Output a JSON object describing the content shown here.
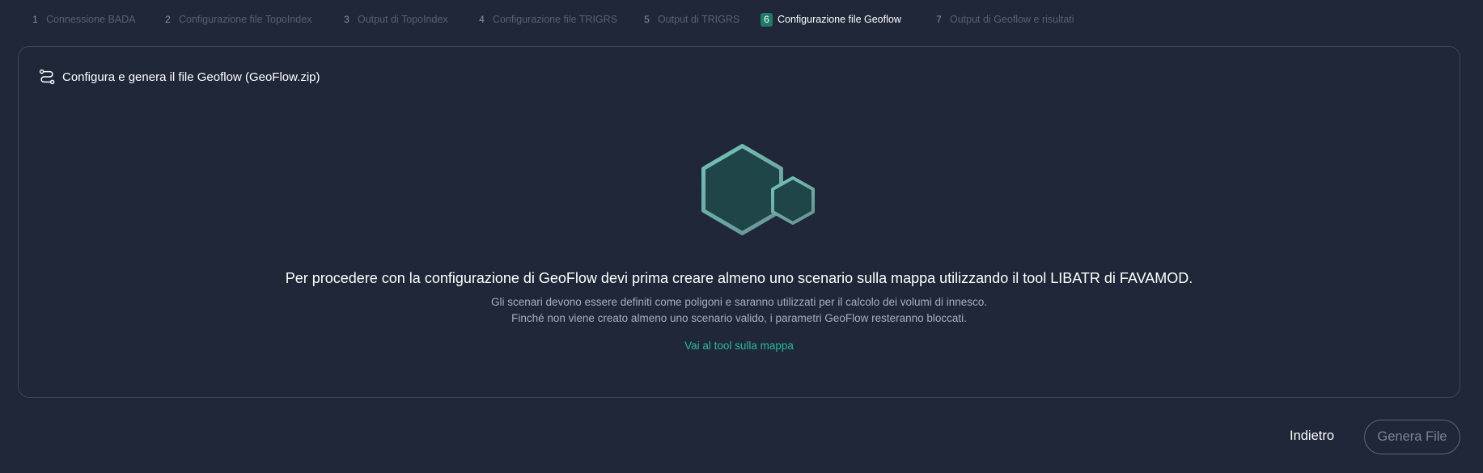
{
  "stepper": {
    "steps": [
      {
        "number": "1",
        "label": "Connessione BADA"
      },
      {
        "number": "2",
        "label": "Configurazione file TopoIndex"
      },
      {
        "number": "3",
        "label": "Output di TopoIndex"
      },
      {
        "number": "4",
        "label": "Configurazione file TRIGRS"
      },
      {
        "number": "5",
        "label": "Output di TRIGRS"
      },
      {
        "number": "6",
        "label": "Configurazione file Geoflow"
      },
      {
        "number": "7",
        "label": "Output di Geoflow e risultati"
      }
    ],
    "active_step": "6"
  },
  "card": {
    "title": "Configura e genera il file Geoflow (GeoFlow.zip)",
    "title_icon": "route-icon",
    "illustration_icon": "hexagons-icon",
    "message": "Per procedere con la configurazione di GeoFlow devi prima creare almeno uno scenario sulla mappa utilizzando il tool LIBATR di FAVAMOD.",
    "detail_line_1": "Gli scenari devono essere definiti come poligoni e saranno utilizzati per il calcolo dei volumi di innesco.",
    "detail_line_2": "Finché non viene creato almeno uno scenario valido, i parametri GeoFlow resteranno bloccati.",
    "link_text": "Vai al tool sulla mappa"
  },
  "footer": {
    "back_label": "Indietro",
    "generate_label": "Genera File"
  },
  "colors": {
    "background": "#1f2738",
    "accent": "#2bb99c",
    "active_step_badge": "#1f7a68",
    "card_border": "#3e4759"
  }
}
